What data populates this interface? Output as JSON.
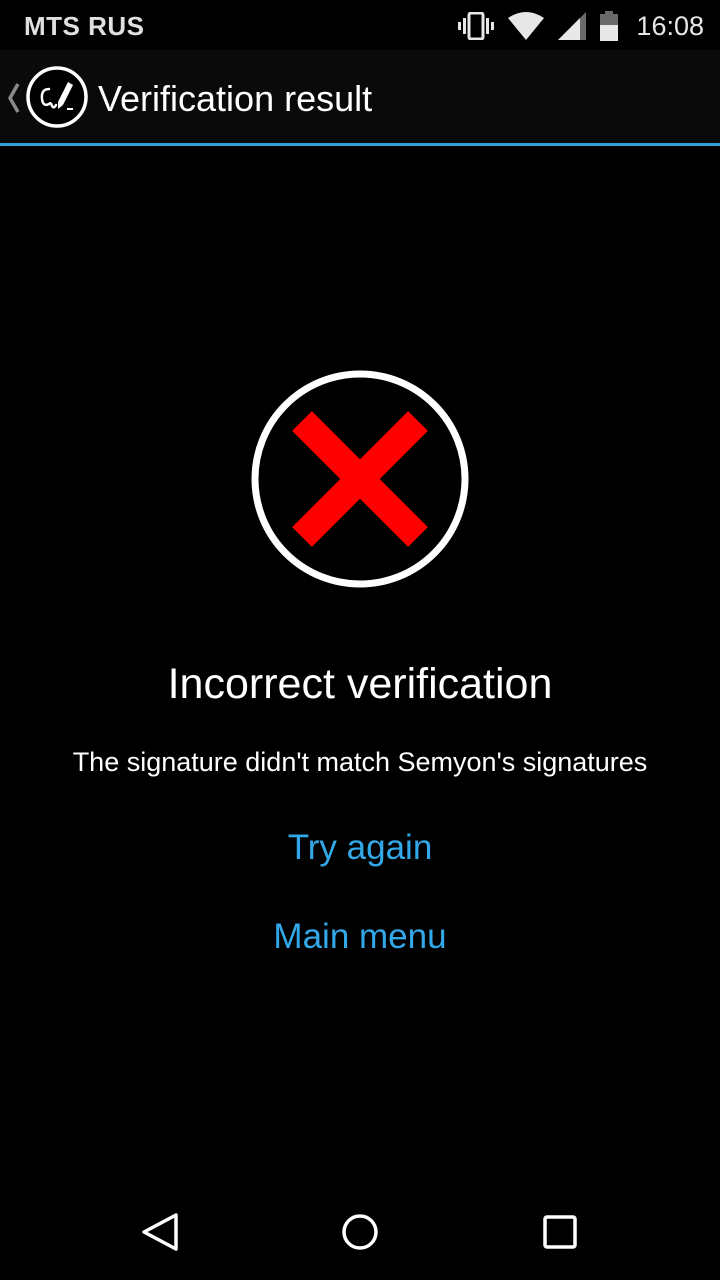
{
  "status_bar": {
    "carrier": "MTS RUS",
    "time": "16:08",
    "icons": [
      "vibrate-icon",
      "wifi-icon",
      "signal-icon",
      "battery-icon"
    ]
  },
  "action_bar": {
    "title": "Verification result",
    "up_icon": "chevron-left-icon",
    "app_icon": "signature-app-icon",
    "divider_color": "#33a0dc"
  },
  "result": {
    "icon": "error-x-icon",
    "icon_color": "#ff0000",
    "headline": "Incorrect verification",
    "message": "The signature didn't match Semyon's signatures"
  },
  "actions": {
    "try_again": "Try again",
    "main_menu": "Main menu",
    "link_color": "#33a8e8"
  },
  "nav_bar": {
    "icons": [
      "back-icon",
      "home-icon",
      "recents-icon"
    ]
  }
}
